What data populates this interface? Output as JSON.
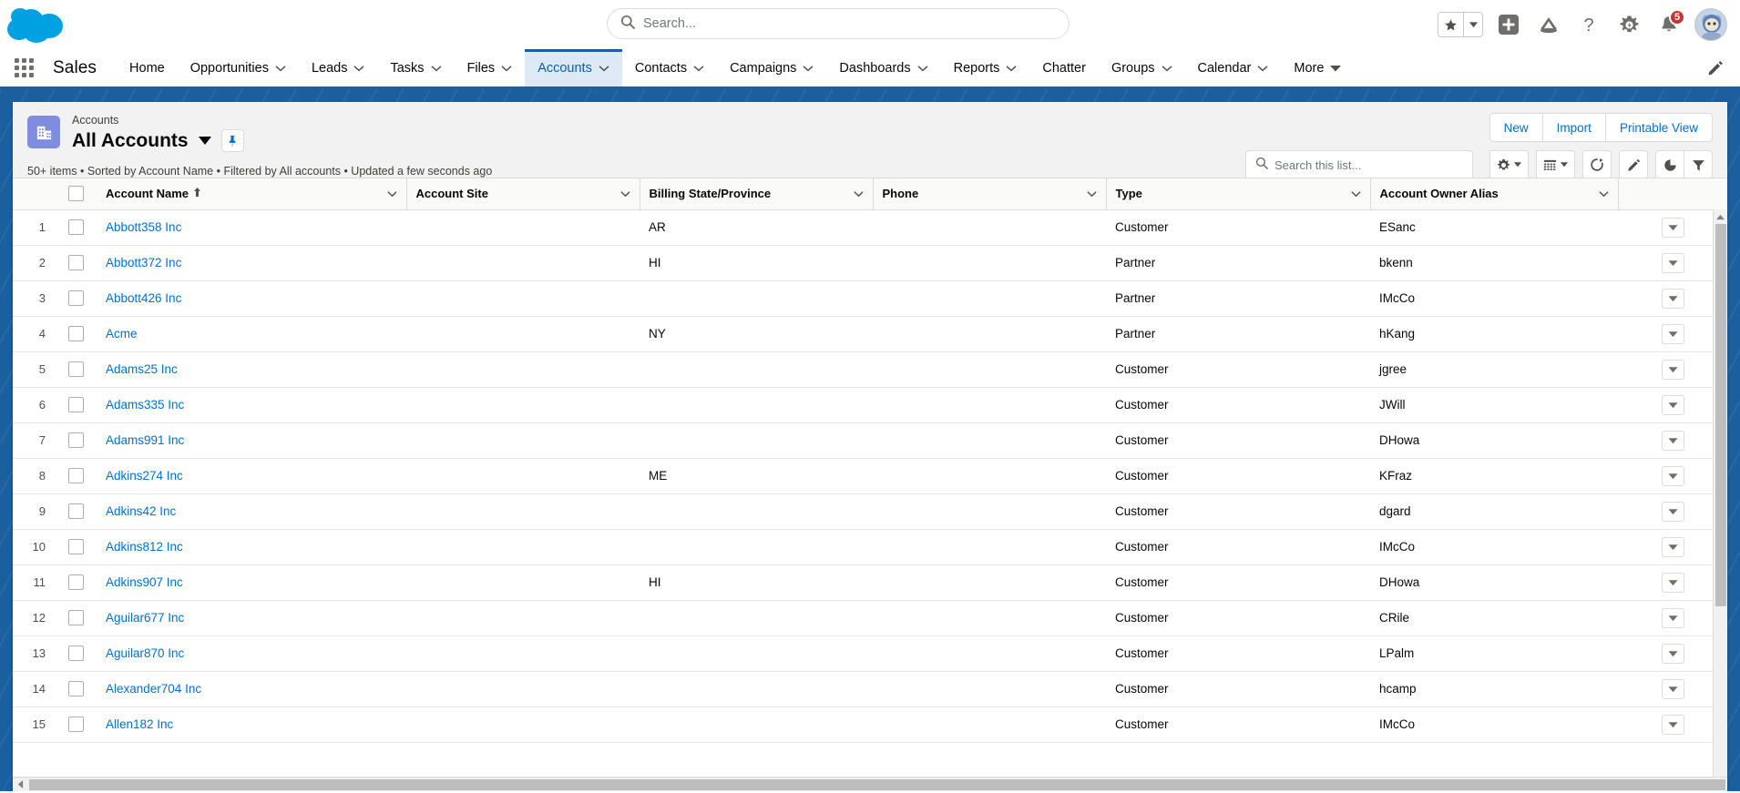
{
  "header": {
    "logo_icon": "salesforce-cloud-logo",
    "search": {
      "placeholder": "Search...",
      "value": "",
      "icon": "search-icon"
    },
    "icons": {
      "favorites": "star-icon",
      "favorites_caret": "chevron-down-icon",
      "add": "plus-icon",
      "einstein": "einstein-icon",
      "help": "help-question-icon",
      "setup": "gear-icon",
      "notifications": "bell-icon",
      "notifications_count": "5",
      "avatar": "user-avatar"
    }
  },
  "nav": {
    "app_launcher_icon": "app-launcher-waffle-icon",
    "app_name": "Sales",
    "edit_icon": "pencil-icon",
    "items": [
      {
        "label": "Home",
        "has_caret": false,
        "active": false
      },
      {
        "label": "Opportunities",
        "has_caret": true,
        "active": false
      },
      {
        "label": "Leads",
        "has_caret": true,
        "active": false
      },
      {
        "label": "Tasks",
        "has_caret": true,
        "active": false
      },
      {
        "label": "Files",
        "has_caret": true,
        "active": false
      },
      {
        "label": "Accounts",
        "has_caret": true,
        "active": true
      },
      {
        "label": "Contacts",
        "has_caret": true,
        "active": false
      },
      {
        "label": "Campaigns",
        "has_caret": true,
        "active": false
      },
      {
        "label": "Dashboards",
        "has_caret": true,
        "active": false
      },
      {
        "label": "Reports",
        "has_caret": true,
        "active": false
      },
      {
        "label": "Chatter",
        "has_caret": false,
        "active": false
      },
      {
        "label": "Groups",
        "has_caret": true,
        "active": false
      },
      {
        "label": "Calendar",
        "has_caret": true,
        "active": false
      },
      {
        "label": "More",
        "has_caret": true,
        "active": false
      }
    ]
  },
  "list_header": {
    "object_icon": "account-object-icon",
    "eyebrow": "Accounts",
    "title": "All Accounts",
    "title_caret_icon": "chevron-down-icon",
    "pin_icon": "pin-icon",
    "meta": "50+ items • Sorted by Account Name • Filtered by All accounts • Updated a few seconds ago",
    "buttons": [
      {
        "label": "New"
      },
      {
        "label": "Import"
      },
      {
        "label": "Printable View"
      }
    ],
    "list_search": {
      "placeholder": "Search this list...",
      "value": "",
      "icon": "search-icon"
    },
    "tool_icons": [
      {
        "name": "list-view-controls-gear-icon",
        "caret": true
      },
      {
        "name": "display-as-table-icon",
        "caret": true
      },
      {
        "name": "refresh-icon",
        "caret": false
      },
      {
        "name": "edit-pencil-icon",
        "caret": false
      },
      {
        "name": "chart-pie-icon",
        "caret": false
      },
      {
        "name": "filter-funnel-icon",
        "caret": false
      }
    ]
  },
  "table": {
    "select_all_icon": "checkbox-unchecked",
    "columns": [
      {
        "label": "Account Name",
        "sorted": true,
        "sort_icon": "arrow-up-icon"
      },
      {
        "label": "Account Site",
        "sorted": false
      },
      {
        "label": "Billing State/Province",
        "sorted": false
      },
      {
        "label": "Phone",
        "sorted": false
      },
      {
        "label": "Type",
        "sorted": false
      },
      {
        "label": "Account Owner Alias",
        "sorted": false
      }
    ],
    "column_menu_icon": "chevron-down-icon",
    "row_action_icon": "chevron-down-icon",
    "rows": [
      {
        "num": "1",
        "name": "Abbott358 Inc",
        "site": "",
        "state": "AR",
        "phone": "",
        "type": "Customer",
        "owner": "ESanc"
      },
      {
        "num": "2",
        "name": "Abbott372 Inc",
        "site": "",
        "state": "HI",
        "phone": "",
        "type": "Partner",
        "owner": "bkenn"
      },
      {
        "num": "3",
        "name": "Abbott426 Inc",
        "site": "",
        "state": "",
        "phone": "",
        "type": "Partner",
        "owner": "IMcCo"
      },
      {
        "num": "4",
        "name": "Acme",
        "site": "",
        "state": "NY",
        "phone": "",
        "type": "Partner",
        "owner": "hKang"
      },
      {
        "num": "5",
        "name": "Adams25 Inc",
        "site": "",
        "state": "",
        "phone": "",
        "type": "Customer",
        "owner": "jgree"
      },
      {
        "num": "6",
        "name": "Adams335 Inc",
        "site": "",
        "state": "",
        "phone": "",
        "type": "Customer",
        "owner": "JWill"
      },
      {
        "num": "7",
        "name": "Adams991 Inc",
        "site": "",
        "state": "",
        "phone": "",
        "type": "Customer",
        "owner": "DHowa"
      },
      {
        "num": "8",
        "name": "Adkins274 Inc",
        "site": "",
        "state": "ME",
        "phone": "",
        "type": "Customer",
        "owner": "KFraz"
      },
      {
        "num": "9",
        "name": "Adkins42 Inc",
        "site": "",
        "state": "",
        "phone": "",
        "type": "Customer",
        "owner": "dgard"
      },
      {
        "num": "10",
        "name": "Adkins812 Inc",
        "site": "",
        "state": "",
        "phone": "",
        "type": "Customer",
        "owner": "IMcCo"
      },
      {
        "num": "11",
        "name": "Adkins907 Inc",
        "site": "",
        "state": "HI",
        "phone": "",
        "type": "Customer",
        "owner": "DHowa"
      },
      {
        "num": "12",
        "name": "Aguilar677 Inc",
        "site": "",
        "state": "",
        "phone": "",
        "type": "Customer",
        "owner": "CRile"
      },
      {
        "num": "13",
        "name": "Aguilar870 Inc",
        "site": "",
        "state": "",
        "phone": "",
        "type": "Customer",
        "owner": "LPalm"
      },
      {
        "num": "14",
        "name": "Alexander704 Inc",
        "site": "",
        "state": "",
        "phone": "",
        "type": "Customer",
        "owner": "hcamp"
      },
      {
        "num": "15",
        "name": "Allen182 Inc",
        "site": "",
        "state": "",
        "phone": "",
        "type": "Customer",
        "owner": "IMcCo"
      }
    ]
  },
  "colors": {
    "brand_blue": "#1b5f9e",
    "link_blue": "#0070d2",
    "cloud_blue": "#00a1e0",
    "badge_red": "#c23934",
    "object_icon_purple": "#7f8de1"
  }
}
